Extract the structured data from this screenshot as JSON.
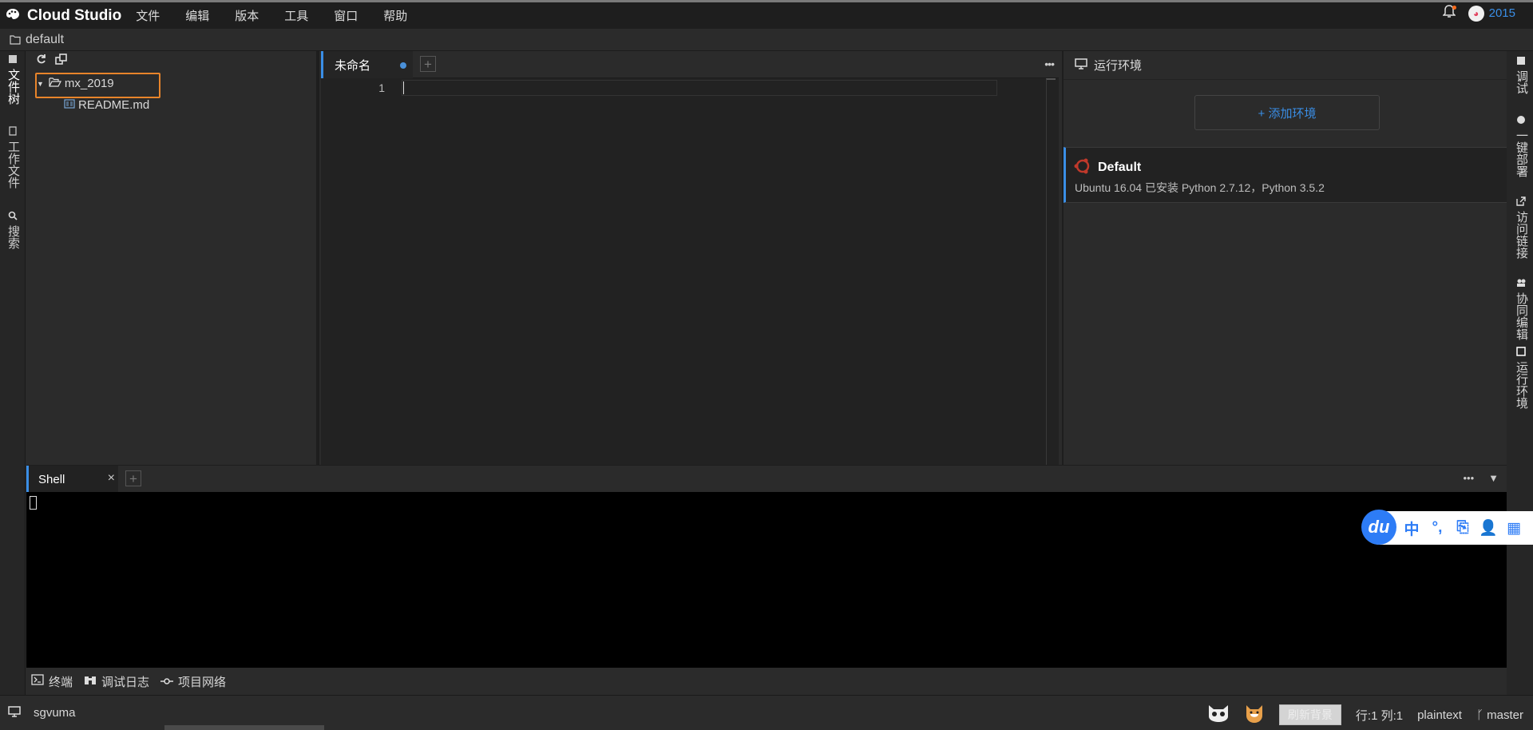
{
  "app": {
    "name": "Cloud Studio"
  },
  "menu": [
    "文件",
    "编辑",
    "版本",
    "工具",
    "窗口",
    "帮助"
  ],
  "user": {
    "name": "2015",
    "avatar": "◕"
  },
  "project": {
    "name": "default"
  },
  "left_rail": [
    "文件树",
    "工作文件",
    "搜索"
  ],
  "right_rail": [
    "调试",
    "一键部署",
    "访问链接",
    "协同编辑",
    "运行环境"
  ],
  "file_tree": {
    "folder": "mx_2019",
    "file": "README.md"
  },
  "editor": {
    "tab_label": "未命名",
    "line_number": "1",
    "more": "•••"
  },
  "run_env": {
    "title": "运行环境",
    "add_button": "+ 添加环境",
    "env_name": "Default",
    "env_desc": "Ubuntu 16.04 已安装 Python 2.7.12，Python 3.5.2"
  },
  "terminal": {
    "tab_label": "Shell",
    "close": "×",
    "more": "•••",
    "collapse": "▼"
  },
  "panel_tabs": [
    "终端",
    "调试日志",
    "项目网络"
  ],
  "ime": {
    "logo": "du",
    "keys": [
      "中",
      "°,",
      "⎘",
      "👤",
      "▦"
    ]
  },
  "status": {
    "workspace": "sgvuma",
    "refresh_bg": "刷新背景",
    "position": "行:1 列:1",
    "language": "plaintext",
    "branch": "master"
  },
  "colors": {
    "accent": "#3a8ee6",
    "highlight_box": "#e8842a",
    "background": "#2b2b2b",
    "terminal_bg": "#000000"
  }
}
